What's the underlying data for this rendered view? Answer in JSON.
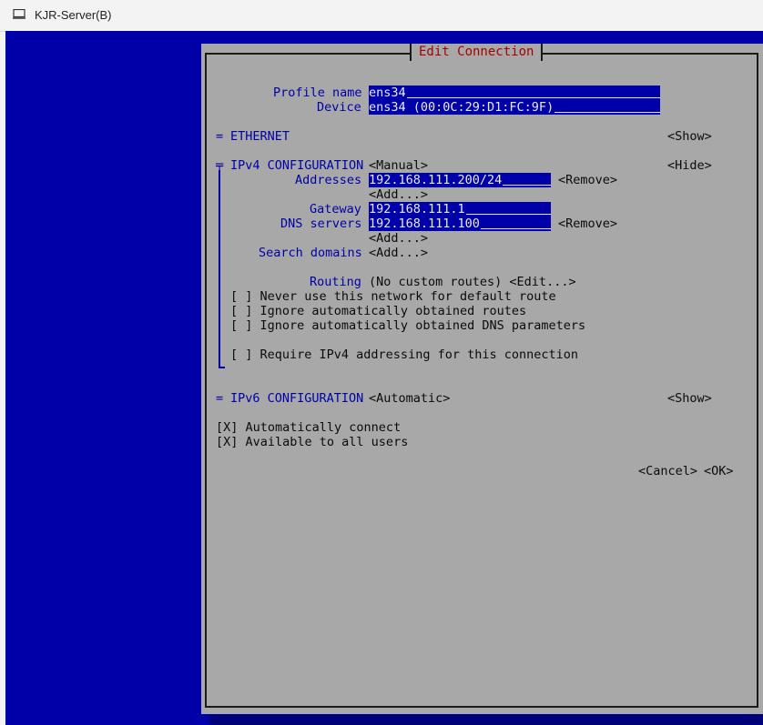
{
  "window": {
    "title": "KJR-Server(B)"
  },
  "dialog": {
    "title": "Edit Connection"
  },
  "profile": {
    "name_label": "Profile name",
    "name_value": "ens34",
    "device_label": "Device",
    "device_value": "ens34 (00:0C:29:D1:FC:9F)"
  },
  "ethernet": {
    "marker": "=",
    "label": "ETHERNET",
    "toggle": "<Show>"
  },
  "ipv4": {
    "marker": "╤",
    "label": "IPv4 CONFIGURATION",
    "mode": "<Manual>",
    "toggle": "<Hide>",
    "addresses_label": "Addresses",
    "address_value": "192.168.111.200/24",
    "remove_label": "<Remove>",
    "add_label": "<Add...>",
    "gateway_label": "Gateway",
    "gateway_value": "192.168.111.1",
    "dns_label": "DNS servers",
    "dns_value": "192.168.111.100",
    "search_label": "Search domains",
    "routing_label": "Routing",
    "routing_value": "(No custom routes) <Edit...>",
    "check_never_default": "[ ] Never use this network for default route",
    "check_ignore_routes": "[ ] Ignore automatically obtained routes",
    "check_ignore_dns": "[ ] Ignore automatically obtained DNS parameters",
    "check_require_ipv4": "[ ] Require IPv4 addressing for this connection"
  },
  "ipv6": {
    "marker": "=",
    "label": "IPv6 CONFIGURATION",
    "mode": "<Automatic>",
    "toggle": "<Show>"
  },
  "options": {
    "auto_connect": "[X] Automatically connect",
    "all_users": "[X] Available to all users"
  },
  "buttons": {
    "cancel": "<Cancel>",
    "ok": "<OK>"
  },
  "colors": {
    "background": "#0000a8",
    "dialog": "#a8a8a8",
    "title": "#a80000"
  }
}
